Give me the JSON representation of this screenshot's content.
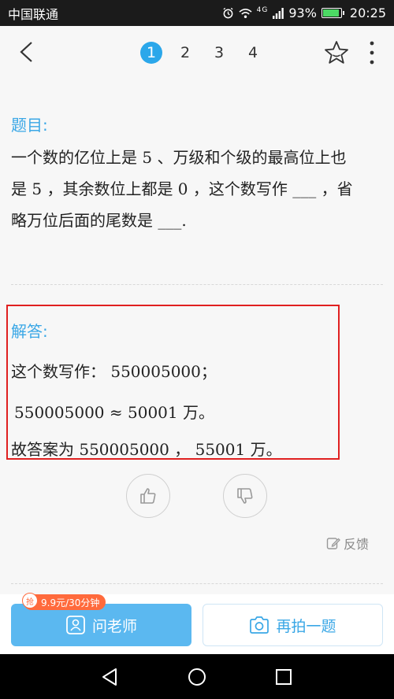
{
  "status_bar": {
    "carrier": "中国联通",
    "network": "4G",
    "battery": "93%",
    "battery_level": 0.93,
    "time": "20:25"
  },
  "nav": {
    "pages": [
      "1",
      "2",
      "3",
      "4"
    ],
    "active_page": "1"
  },
  "question": {
    "title": "题目:",
    "lines": [
      "一个数的亿位上是 5 、万级和个级的最高位上也",
      "是 5 ，其余数位上都是 0 ，这个数写作 ___ ，省",
      "略万位后面的尾数是 ___."
    ]
  },
  "answer": {
    "title": "解答:",
    "lines": [
      "这个数写作： 550005000；",
      "550005000 ≈ 50001 万。",
      "故答案为 550005000 ， 55001 万。"
    ]
  },
  "feedback": {
    "label": "反馈"
  },
  "bottom": {
    "price_badge": "9.9元/30分钟",
    "price_badge_tag": "抢",
    "ask_teacher_label": "问老师",
    "retake_label": "再拍一题"
  },
  "colors": {
    "accent": "#2ba7ea",
    "highlight_border": "#e02020",
    "badge": "#ff6a3c"
  }
}
